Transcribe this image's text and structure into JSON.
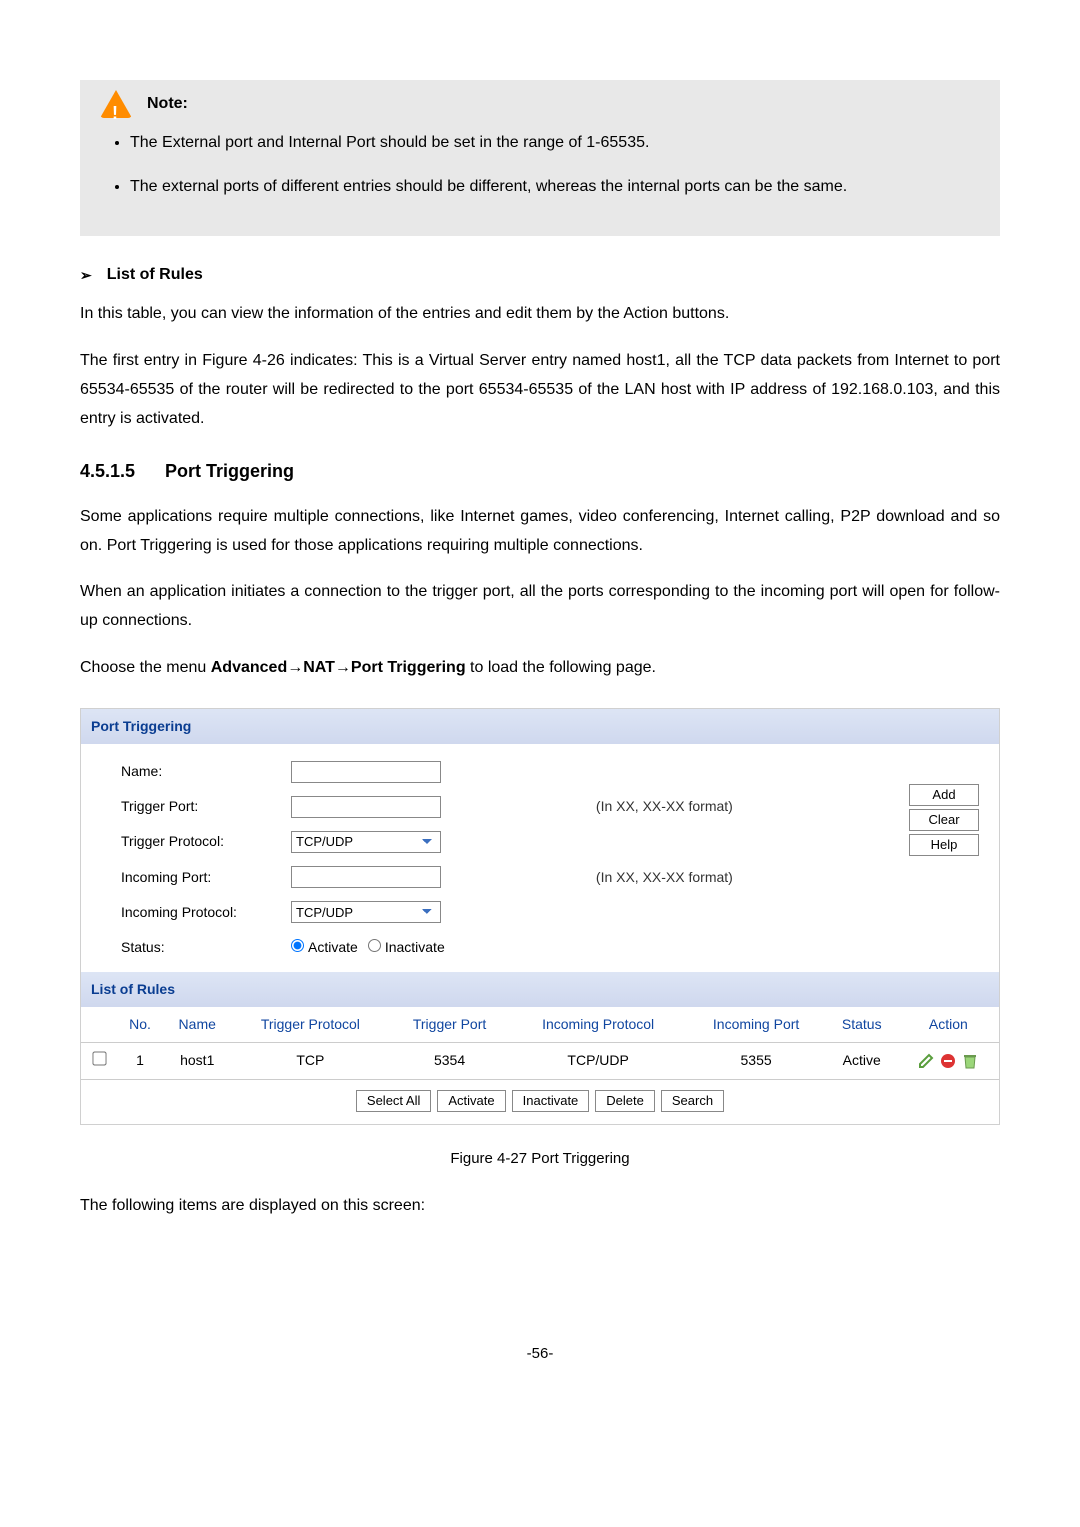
{
  "note": {
    "label": "Note:",
    "bullets": [
      "The External port and Internal Port should be set in the range of 1-65535.",
      "The external ports of different entries should be different, whereas the internal ports can be the same."
    ]
  },
  "list_of_rules_heading": "List of Rules",
  "list_intro": "In this table, you can view the information of the entries and edit them by the Action buttons.",
  "first_entry_para": "The first entry in Figure 4-26 indicates: This is a Virtual Server entry named host1, all the TCP data packets from Internet to port 65534-65535 of the router will be redirected to the port 65534-65535 of the LAN host with IP address of 192.168.0.103, and this entry is activated.",
  "section_number": "4.5.1.5",
  "section_title": "Port Triggering",
  "pt_para1": "Some applications require multiple connections, like Internet games, video conferencing, Internet calling, P2P download and so on. Port Triggering is used for those applications requiring multiple connections.",
  "pt_para2": "When an application initiates a connection to the trigger port, all the ports corresponding to the incoming port will open for follow-up connections.",
  "menu_prefix": "Choose the menu ",
  "menu_path": "Advanced→NAT→Port Triggering",
  "menu_suffix": " to load the following page.",
  "ui": {
    "panel_title": "Port Triggering",
    "labels": {
      "name": "Name:",
      "trigger_port": "Trigger Port:",
      "trigger_protocol": "Trigger Protocol:",
      "incoming_port": "Incoming Port:",
      "incoming_protocol": "Incoming Protocol:",
      "status": "Status:"
    },
    "format_hint": "(In XX, XX-XX format)",
    "protocol_option": "TCP/UDP",
    "status_activate": "Activate",
    "status_inactivate": "Inactivate",
    "side_buttons": {
      "add": "Add",
      "clear": "Clear",
      "help": "Help"
    },
    "list_title": "List of Rules",
    "table": {
      "headers": [
        "No.",
        "Name",
        "Trigger Protocol",
        "Trigger Port",
        "Incoming Protocol",
        "Incoming Port",
        "Status",
        "Action"
      ],
      "row": {
        "no": "1",
        "name": "host1",
        "trigger_protocol": "TCP",
        "trigger_port": "5354",
        "incoming_protocol": "TCP/UDP",
        "incoming_port": "5355",
        "status": "Active"
      }
    },
    "bottom_buttons": {
      "select_all": "Select All",
      "activate": "Activate",
      "inactivate": "Inactivate",
      "delete": "Delete",
      "search": "Search"
    }
  },
  "figure_caption": "Figure 4-27 Port Triggering",
  "following_items": "The following items are displayed on this screen:",
  "page_number": "-56-"
}
